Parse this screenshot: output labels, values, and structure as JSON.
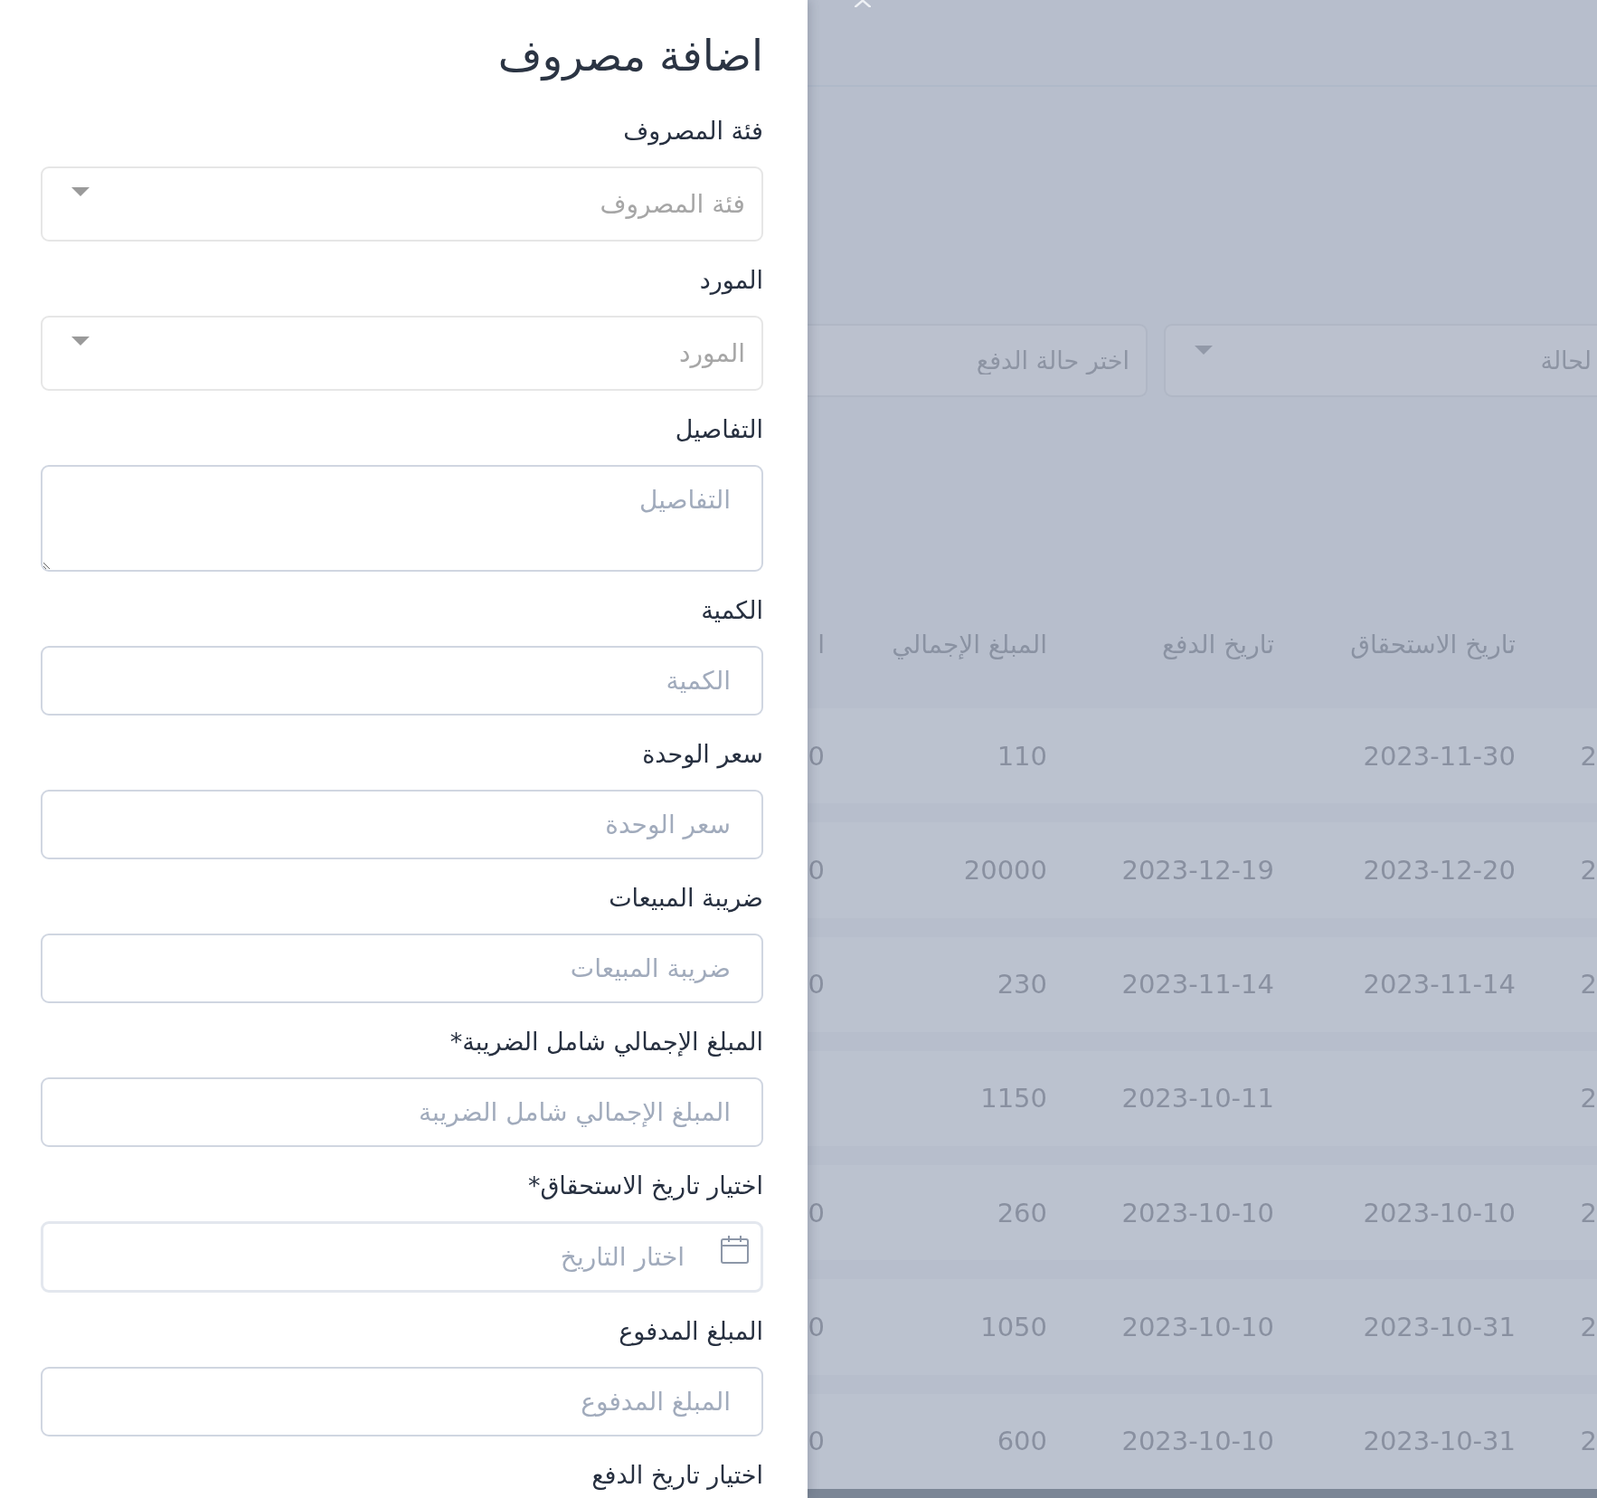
{
  "drawer": {
    "title": "اضافة مصروف",
    "fields": [
      {
        "kind": "select",
        "label": "فئة المصروف",
        "placeholder": "فئة المصروف"
      },
      {
        "kind": "select",
        "label": "المورد",
        "placeholder": "المورد"
      },
      {
        "kind": "textarea",
        "label": "التفاصيل",
        "placeholder": "التفاصيل"
      },
      {
        "kind": "text",
        "label": "الكمية",
        "placeholder": "الكمية"
      },
      {
        "kind": "text",
        "label": "سعر الوحدة",
        "placeholder": "سعر الوحدة"
      },
      {
        "kind": "text",
        "label": "ضريبة المبيعات",
        "placeholder": "ضريبة المبيعات"
      },
      {
        "kind": "text",
        "label": "المبلغ الإجمالي شامل الضريبة*",
        "placeholder": "المبلغ الإجمالي شامل الضريبة"
      },
      {
        "kind": "date",
        "label": "اختيار تاريخ الاستحقاق*",
        "placeholder": "اختار التاريخ"
      },
      {
        "kind": "text",
        "label": "المبلغ المدفوع",
        "placeholder": "المبلغ المدفوع"
      },
      {
        "label": "اختيار تاريخ الدفع"
      }
    ]
  },
  "page": {
    "filters": [
      {
        "kind": "select",
        "placeholder": "لحالة"
      },
      {
        "kind": "input",
        "placeholder": "اختر حالة الدفع"
      }
    ],
    "table": {
      "columns": {
        "due_date": "تاريخ الاستحقاق",
        "payment_date": "تاريخ الدفع",
        "total_amount": "المبلغ الإجمالي",
        "column_5": "ا"
      },
      "rows": [
        {
          "column_1": "2",
          "due_date": "2023-11-30",
          "total_amount": "110",
          "column_5": "0"
        },
        {
          "column_1": "2",
          "due_date": "2023-12-20",
          "payment_date": "2023-12-19",
          "total_amount": "20000",
          "column_5": "0"
        },
        {
          "column_1": "2",
          "due_date": "2023-11-14",
          "payment_date": "2023-11-14",
          "total_amount": "230",
          "column_5": "0"
        },
        {
          "column_1": "2",
          "payment_date": "2023-10-11",
          "total_amount": "1150"
        },
        {
          "column_1": "2",
          "due_date": "2023-10-10",
          "payment_date": "2023-10-10",
          "total_amount": "260",
          "column_5": "0"
        },
        {
          "column_1": "2",
          "due_date": "2023-10-31",
          "payment_date": "2023-10-10",
          "total_amount": "1050",
          "column_5": "0"
        },
        {
          "column_1": "2",
          "due_date": "2023-10-31",
          "payment_date": "2023-10-10",
          "total_amount": "600",
          "column_5": "0"
        }
      ]
    }
  }
}
